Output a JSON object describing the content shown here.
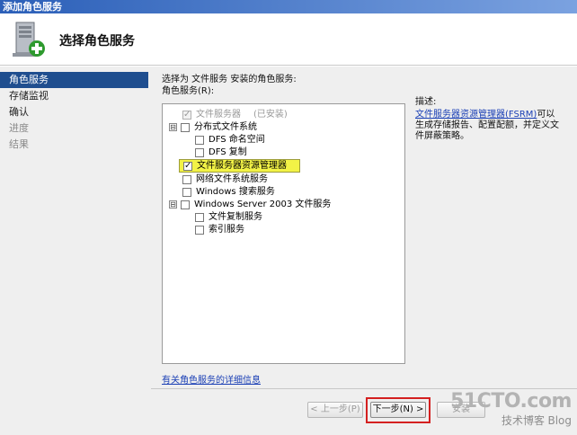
{
  "window": {
    "title": "添加角色服务"
  },
  "header": {
    "title": "选择角色服务"
  },
  "nav": {
    "items": [
      {
        "label": "角色服务",
        "state": "active"
      },
      {
        "label": "存储监视",
        "state": "normal"
      },
      {
        "label": "确认",
        "state": "normal"
      },
      {
        "label": "进度",
        "state": "disabled"
      },
      {
        "label": "结果",
        "state": "disabled"
      }
    ]
  },
  "content": {
    "intro": "选择为 文件服务 安装的角色服务:",
    "list_label": "角色服务(R):",
    "tree": [
      {
        "label": "文件服务器",
        "note": "(已安装)",
        "checked": true,
        "disabled": true,
        "expander": ""
      },
      {
        "label": "分布式文件系统",
        "checked": false,
        "disabled": false,
        "expander": "⊟"
      },
      {
        "label": "DFS 命名空间",
        "checked": false,
        "disabled": false
      },
      {
        "label": "DFS 复制",
        "checked": false,
        "disabled": false
      },
      {
        "label": "文件服务器资源管理器",
        "checked": true,
        "disabled": false,
        "highlight": true
      },
      {
        "label": "网络文件系统服务",
        "checked": false,
        "disabled": false
      },
      {
        "label": "Windows 搜索服务",
        "checked": false,
        "disabled": false
      },
      {
        "label": "Windows Server 2003 文件服务",
        "checked": false,
        "disabled": false,
        "expander": "⊟"
      },
      {
        "label": "文件复制服务",
        "checked": false,
        "disabled": false
      },
      {
        "label": "索引服务",
        "checked": false,
        "disabled": false
      }
    ],
    "more_link": "有关角色服务的详细信息"
  },
  "description": {
    "title": "描述:",
    "link": "文件服务器资源管理器(FSRM)",
    "text": "可以生成存储报告、配置配额，并定义文件屏蔽策略。"
  },
  "buttons": {
    "prev": "< 上一步(P)",
    "next": "下一步(N) >",
    "install": "安装"
  },
  "watermark": {
    "main": "51CTO.com",
    "sub": "技术博客",
    "blog": "Blog"
  },
  "colors": {
    "nav_active": "#1f4e8f",
    "highlight": "#f2f246",
    "link": "#1a3fb5",
    "callout": "#d42020"
  }
}
